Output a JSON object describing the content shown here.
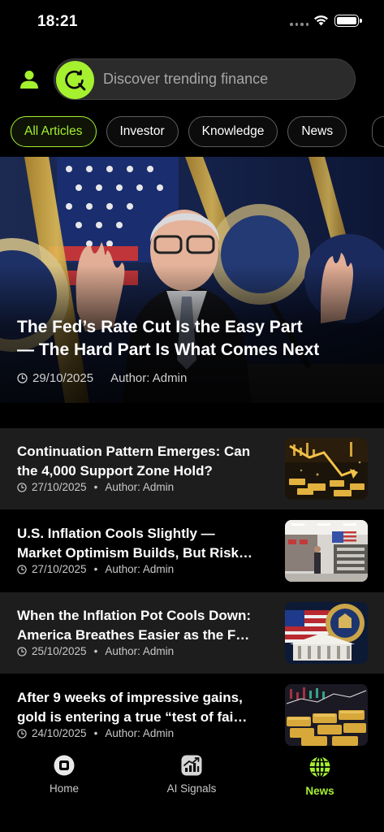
{
  "status_bar": {
    "time": "18:21"
  },
  "search": {
    "placeholder": "Discover trending finance"
  },
  "tabs": [
    {
      "label": "All Articles",
      "active": true
    },
    {
      "label": "Investor",
      "active": false
    },
    {
      "label": "Knowledge",
      "active": false
    },
    {
      "label": "News",
      "active": false
    }
  ],
  "featured": {
    "title_line1": "The Fed’s Rate Cut Is the Easy Part",
    "title_line2": "— The Hard Part Is What Comes Next",
    "date": "29/10/2025",
    "author": "Author: Admin"
  },
  "articles": [
    {
      "title_line1": "Continuation Pattern Emerges: Can",
      "title_line2": "the 4,000 Support Zone Hold?",
      "date": "27/10/2025",
      "author": "Author: Admin",
      "separator": "•"
    },
    {
      "title_line1": "U.S. Inflation Cools Slightly —",
      "title_line2": "Market Optimism Builds, But Risk…",
      "date": "27/10/2025",
      "author": "Author: Admin",
      "separator": "•"
    },
    {
      "title_line1": "When the Inflation Pot Cools Down:",
      "title_line2": "America Breathes Easier as the F…",
      "date": "25/10/2025",
      "author": "Author: Admin",
      "separator": "•"
    },
    {
      "title_line1": "After 9 weeks of impressive gains,",
      "title_line2": "gold is entering a true “test of fai…",
      "date": "24/10/2025",
      "author": "Author: Admin",
      "separator": "•"
    }
  ],
  "nav": {
    "home": "Home",
    "signals": "AI Signals",
    "news": "News",
    "active": "news"
  },
  "colors": {
    "accent": "#a5f02f",
    "background": "#000000",
    "row_alt": "#1d1d1d"
  },
  "icons": [
    "user-icon",
    "search-refresh-icon",
    "clock-icon",
    "home-icon",
    "chart-icon",
    "globe-icon",
    "wifi-icon",
    "battery-icon"
  ]
}
